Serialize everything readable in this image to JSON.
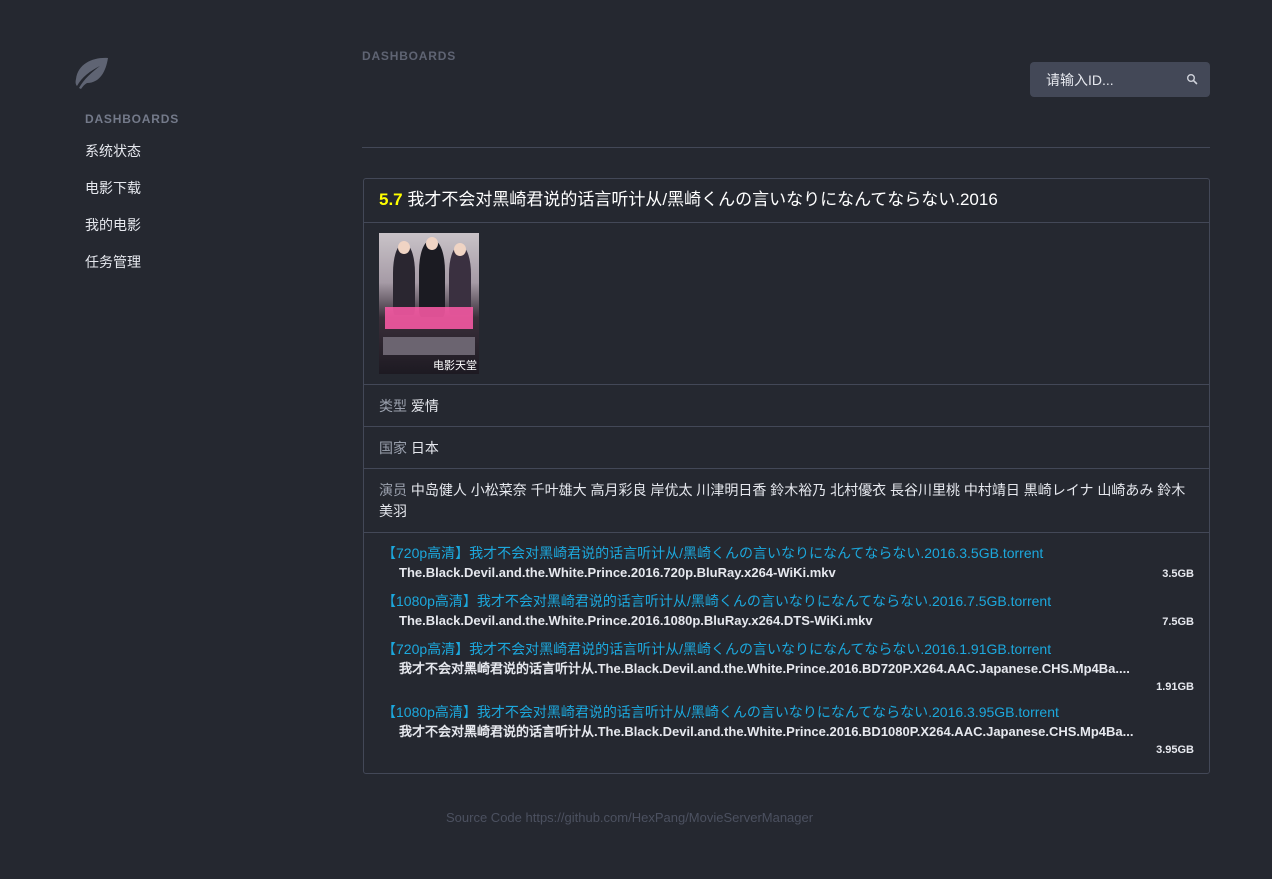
{
  "sidebar": {
    "header": "DASHBOARDS",
    "items": [
      {
        "label": "系统状态"
      },
      {
        "label": "电影下载"
      },
      {
        "label": "我的电影"
      },
      {
        "label": "任务管理"
      }
    ]
  },
  "header": {
    "title": "DASHBOARDS"
  },
  "search": {
    "placeholder": "请输入ID..."
  },
  "movie": {
    "rating": "5.7",
    "title": "我才不会对黑崎君说的话言听计从/黑崎くんの言いなりになんてならない.2016",
    "poster_watermark": "电影天堂",
    "genre_label": "类型",
    "genre": "爱情",
    "country_label": "国家",
    "country": "日本",
    "cast_label": "演员",
    "cast": "中岛健人 小松菜奈 千叶雄大 高月彩良 岸优太 川津明日香 鈴木裕乃 北村優衣 長谷川里桃 中村靖日 黒崎レイナ 山崎あみ 鈴木美羽"
  },
  "downloads": [
    {
      "link": "【720p高清】我才不会对黑崎君说的话言听计从/黑崎くんの言いなりになんてならない.2016.3.5GB.torrent",
      "file": "The.Black.Devil.and.the.White.Prince.2016.720p.BluRay.x264-WiKi.mkv",
      "size": "3.5GB"
    },
    {
      "link": "【1080p高清】我才不会对黑崎君说的话言听计从/黑崎くんの言いなりになんてならない.2016.7.5GB.torrent",
      "file": "The.Black.Devil.and.the.White.Prince.2016.1080p.BluRay.x264.DTS-WiKi.mkv",
      "size": "7.5GB"
    },
    {
      "link": "【720p高清】我才不会对黑崎君说的话言听计从/黑崎くんの言いなりになんてならない.2016.1.91GB.torrent",
      "file": "我才不会对黑崎君说的话言听计从.The.Black.Devil.and.the.White.Prince.2016.BD720P.X264.AAC.Japanese.CHS.Mp4Ba....",
      "size": "1.91GB"
    },
    {
      "link": "【1080p高清】我才不会对黑崎君说的话言听计从/黑崎くんの言いなりになんてならない.2016.3.95GB.torrent",
      "file": "我才不会对黑崎君说的话言听计从.The.Black.Devil.and.the.White.Prince.2016.BD1080P.X264.AAC.Japanese.CHS.Mp4Ba...",
      "size": "3.95GB"
    }
  ],
  "footer": {
    "text": "Source Code https://github.com/HexPang/MovieServerManager"
  },
  "colors": {
    "background": "#252830",
    "rating": "#ffff00",
    "link": "#1ca8dd",
    "border": "#434857"
  }
}
